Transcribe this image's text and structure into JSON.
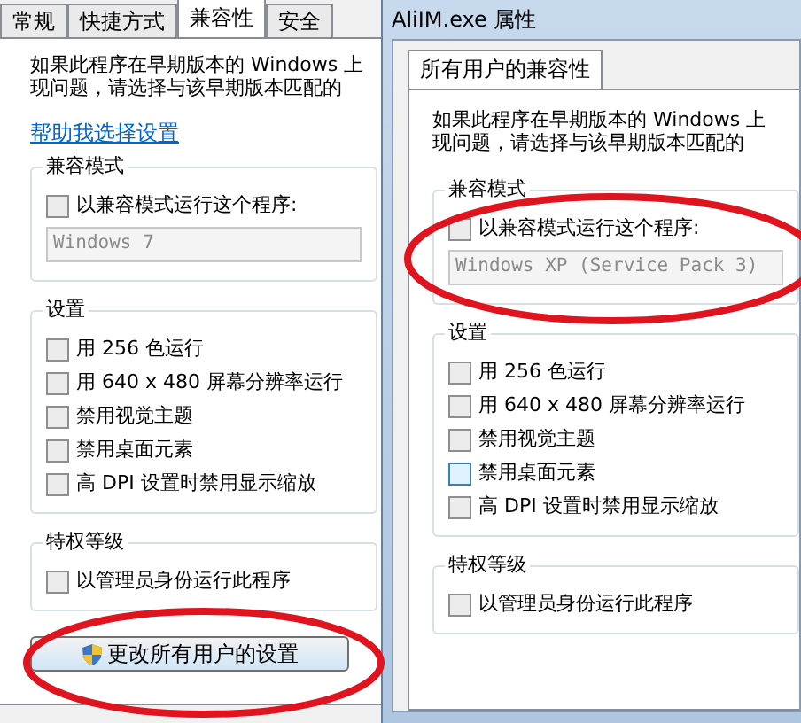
{
  "left_dialog": {
    "tabs": [
      {
        "label": "常规",
        "selected": false
      },
      {
        "label": "快捷方式",
        "selected": false
      },
      {
        "label": "兼容性",
        "selected": true
      },
      {
        "label": "安全",
        "selected": false
      }
    ],
    "intro": [
      "如果此程序在早期版本的 Windows 上",
      "现问题，请选择与该早期版本匹配的"
    ],
    "help_link": "帮助我选择设置",
    "compat_group": {
      "title": "兼容模式",
      "checkbox": {
        "label": "以兼容模式运行这个程序:",
        "checked": false,
        "hovered": false
      },
      "os_select": "Windows 7"
    },
    "settings_group": {
      "title": "设置",
      "options": [
        {
          "label": "用 256 色运行",
          "checked": false,
          "hovered": false
        },
        {
          "label": "用 640 x 480 屏幕分辨率运行",
          "checked": false,
          "hovered": false
        },
        {
          "label": "禁用视觉主题",
          "checked": false,
          "hovered": false
        },
        {
          "label": "禁用桌面元素",
          "checked": false,
          "hovered": false
        },
        {
          "label": "高 DPI 设置时禁用显示缩放",
          "checked": false,
          "hovered": false
        }
      ]
    },
    "privilege_group": {
      "title": "特权等级",
      "options": [
        {
          "label": "以管理员身份运行此程序",
          "checked": false,
          "hovered": false
        }
      ]
    },
    "button": "更改所有用户的设置"
  },
  "right_dialog": {
    "title": "AliIM.exe 属性",
    "tabs": [
      {
        "label": "所有用户的兼容性",
        "selected": true
      }
    ],
    "intro": [
      "如果此程序在早期版本的 Windows 上",
      "现问题，请选择与该早期版本匹配的"
    ],
    "compat_group": {
      "title": "兼容模式",
      "checkbox": {
        "label": "以兼容模式运行这个程序:",
        "checked": false,
        "hovered": false
      },
      "os_select": "Windows XP (Service Pack 3)"
    },
    "settings_group": {
      "title": "设置",
      "options": [
        {
          "label": "用 256 色运行",
          "checked": false,
          "hovered": false
        },
        {
          "label": "用 640 x 480 屏幕分辨率运行",
          "checked": false,
          "hovered": false
        },
        {
          "label": "禁用视觉主题",
          "checked": false,
          "hovered": false
        },
        {
          "label": "禁用桌面元素",
          "checked": false,
          "hovered": true
        },
        {
          "label": "高 DPI 设置时禁用显示缩放",
          "checked": false,
          "hovered": false
        }
      ]
    },
    "privilege_group": {
      "title": "特权等级",
      "options": [
        {
          "label": "以管理员身份运行此程序",
          "checked": false,
          "hovered": false
        }
      ]
    }
  }
}
